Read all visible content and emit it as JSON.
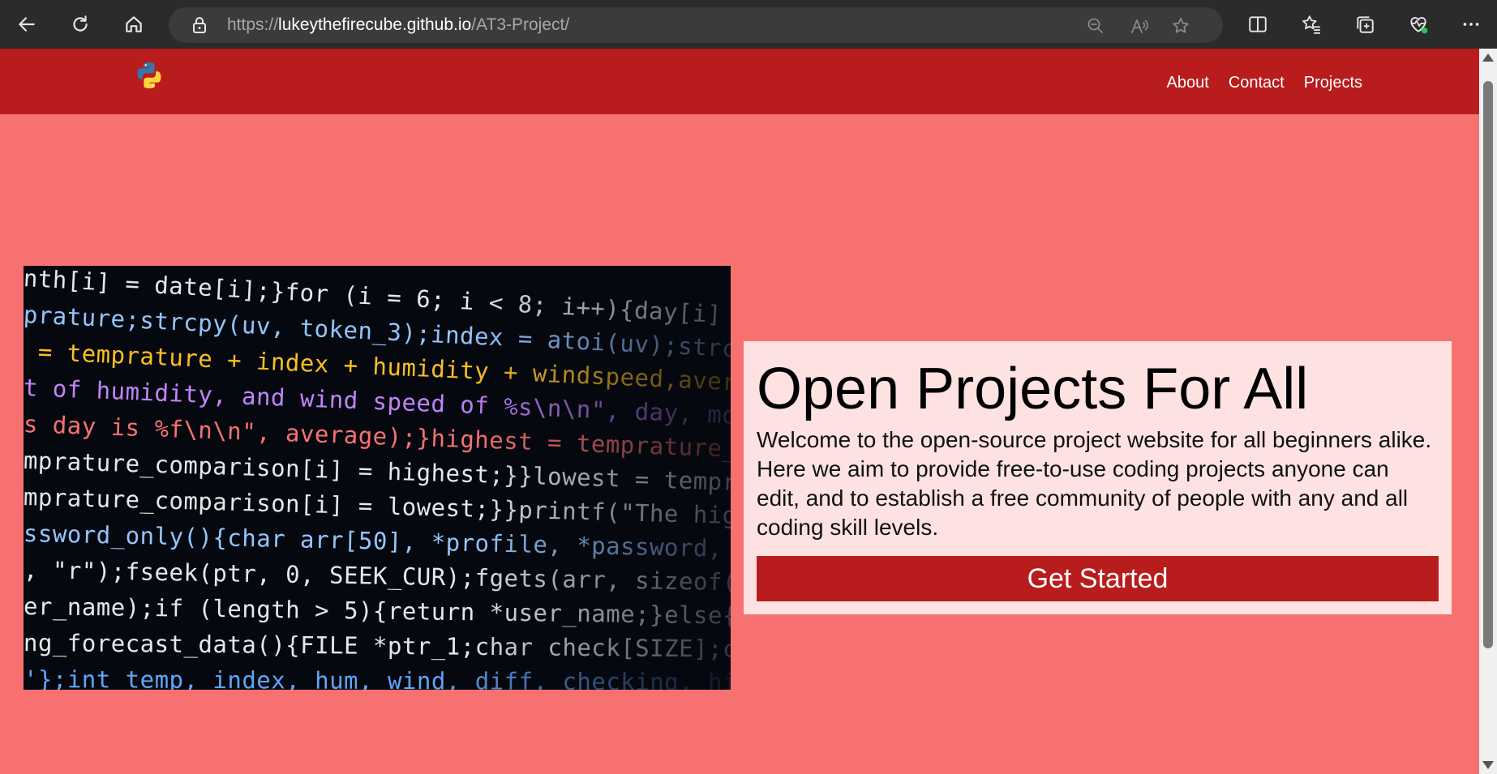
{
  "browser": {
    "url_prefix": "https://",
    "url_host": "lukeythefirecube.github.io",
    "url_path": "/AT3-Project/",
    "icons": {
      "back": "back-arrow-icon",
      "refresh": "refresh-icon",
      "home": "home-icon",
      "lock": "lock-icon",
      "zoom": "zoom-out-icon",
      "read_aloud": "read-aloud-icon",
      "favorite": "star-icon",
      "split_screen": "split-screen-icon",
      "favorites": "favorites-icon",
      "collections": "collections-icon",
      "performance": "heart-pulse-icon",
      "more": "more-icon"
    }
  },
  "site": {
    "logo": "python-logo",
    "nav": [
      "About",
      "Contact",
      "Projects"
    ]
  },
  "hero": {
    "title": "Open Projects For All",
    "text": "Welcome to the open-source project website for all beginners alike. Here we aim to provide free-to-use coding projects anyone can edit, and to establish a free community of people with any and all coding skill levels.",
    "cta": "Get Started"
  },
  "code_image": {
    "lines": [
      "nth[i] = date[i];}for (i = 6; i < 8; i++){day[i] = date[i",
      "prature;strcpy(uv, token_3);index = atoi(uv);strcpy(humi",
      " = temprature + index + humidity + windspeed,average = s",
      "t of humidity, and wind speed of %s\\n\\n\", day, month, ",
      "s day is %f\\n\\n\", average);}highest = temprature_compari",
      "mprature_comparison[i] = highest;}}lowest = temprature_co",
      "mprature_comparison[i] = lowest;}}printf(\"The highest te",
      "ssword_only(){char arr[50], *profile, *password, *user_n",
      ", \"r\");fseek(ptr, 0, SEEK_CUR);fgets(arr, sizeof(arr), ",
      "er_name);if (length > 5){return *user_name;}else{passwor",
      "ng_forecast_data(){FILE *ptr_1;char check[SIZE];char ne",
      "'};int temp, index, hum, wind, diff, checking, high"
    ]
  },
  "colors": {
    "nav_bg": "#b91c1c",
    "page_bg": "#f87171",
    "card_bg": "#fee2e2",
    "button_bg": "#b91c1c"
  }
}
